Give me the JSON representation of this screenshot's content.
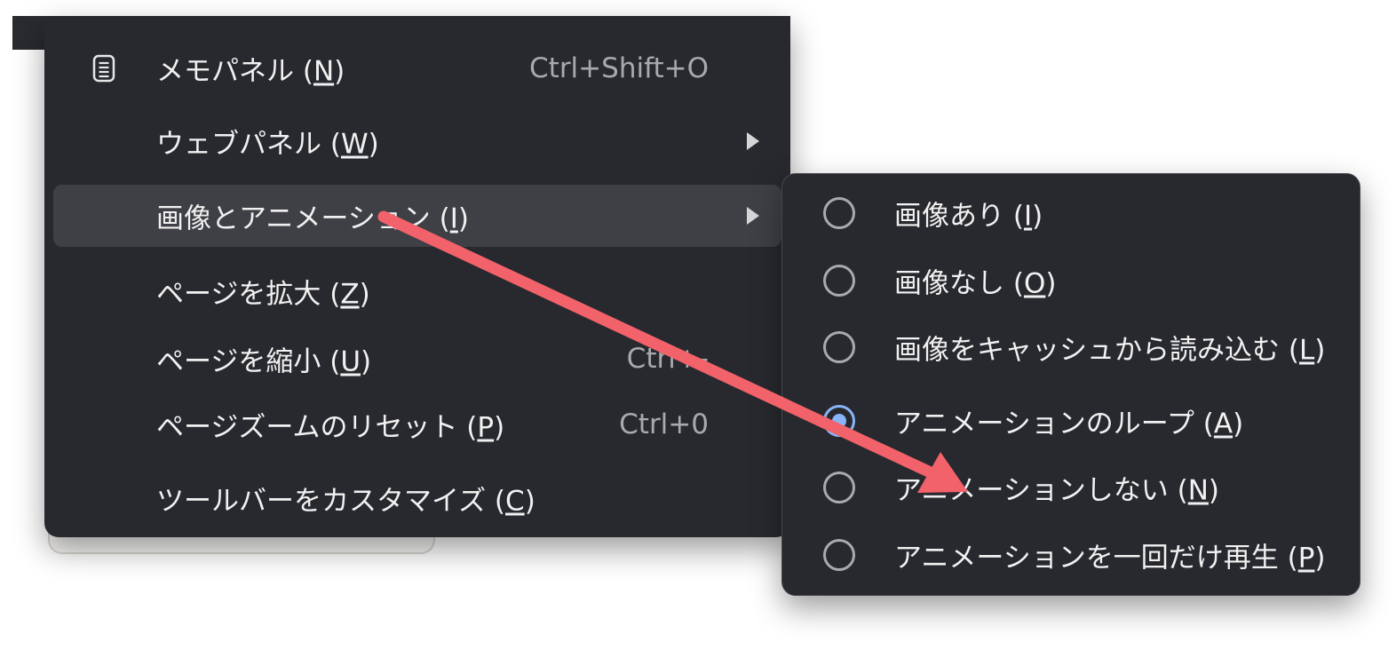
{
  "main_menu": {
    "items": [
      {
        "label": "メモパネル",
        "accel": "N",
        "shortcut": "Ctrl+Shift+O",
        "icon": "memo-panel-icon"
      },
      {
        "label": "ウェブパネル",
        "accel": "W",
        "submenu": true
      },
      {
        "label": "画像とアニメーション",
        "accel": "I",
        "submenu": true,
        "active": true
      },
      {
        "label": "ページを拡大",
        "accel": "Z"
      },
      {
        "label": "ページを縮小",
        "accel": "U",
        "shortcut": "Ctrl+-"
      },
      {
        "label": "ページズームのリセット",
        "accel": "P",
        "shortcut": "Ctrl+0"
      },
      {
        "label": "ツールバーをカスタマイズ",
        "accel": "C"
      }
    ]
  },
  "sub_menu": {
    "items": [
      {
        "label": "画像あり",
        "accel": "I",
        "checked": false
      },
      {
        "label": "画像なし",
        "accel": "O",
        "checked": false
      },
      {
        "label": "画像をキャッシュから読み込む",
        "accel": "L",
        "checked": false
      },
      {
        "label": "アニメーションのループ",
        "accel": "A",
        "checked": true
      },
      {
        "label": "アニメーションしない",
        "accel": "N",
        "checked": false
      },
      {
        "label": "アニメーションを一回だけ再生",
        "accel": "P",
        "checked": false
      }
    ]
  },
  "annotation": {
    "type": "arrow",
    "color": "#f2626a"
  },
  "colors": {
    "menu_bg": "#28292e",
    "active_bg": "#3f4045",
    "radio_checked": "#8ab4f8"
  }
}
